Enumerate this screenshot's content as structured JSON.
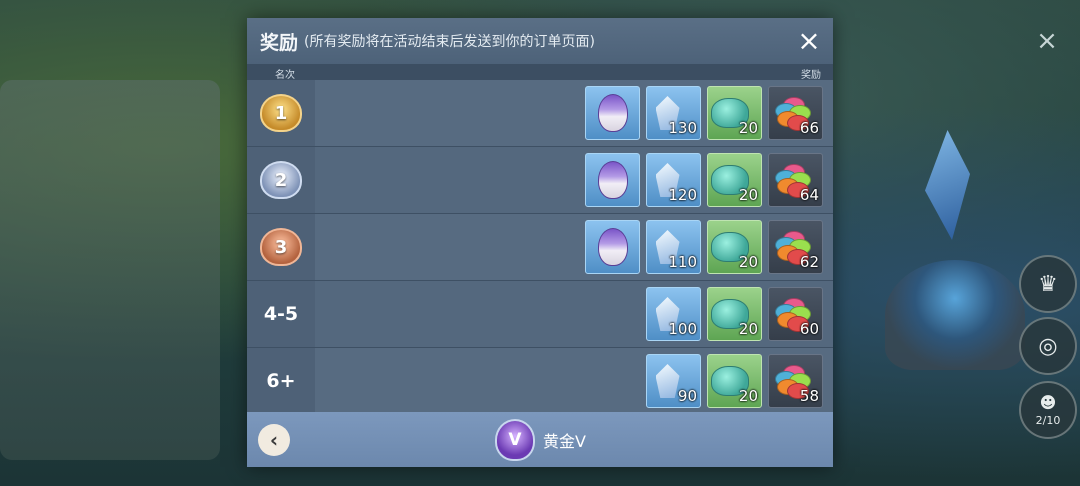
{
  "panel": {
    "title": "奖励",
    "subtitle": "(所有奖励将在活动结束后发送到你的订单页面)",
    "col_rank": "名次",
    "col_reward": "奖励",
    "close_icon": "×"
  },
  "rows": [
    {
      "rank": "1",
      "medal": "gold",
      "items": [
        {
          "type": "egg",
          "qty": ""
        },
        {
          "type": "gem",
          "qty": "130"
        },
        {
          "type": "pot",
          "qty": "20"
        },
        {
          "type": "coins",
          "qty": "66"
        }
      ]
    },
    {
      "rank": "2",
      "medal": "silver",
      "items": [
        {
          "type": "egg",
          "qty": ""
        },
        {
          "type": "gem",
          "qty": "120"
        },
        {
          "type": "pot",
          "qty": "20"
        },
        {
          "type": "coins",
          "qty": "64"
        }
      ]
    },
    {
      "rank": "3",
      "medal": "bronze",
      "items": [
        {
          "type": "egg",
          "qty": ""
        },
        {
          "type": "gem",
          "qty": "110"
        },
        {
          "type": "pot",
          "qty": "20"
        },
        {
          "type": "coins",
          "qty": "62"
        }
      ]
    },
    {
      "rank": "4-5",
      "medal": "",
      "items": [
        {
          "type": "gem",
          "qty": "100"
        },
        {
          "type": "pot",
          "qty": "20"
        },
        {
          "type": "coins",
          "qty": "60"
        }
      ]
    },
    {
      "rank": "6+",
      "medal": "",
      "items": [
        {
          "type": "gem",
          "qty": "90"
        },
        {
          "type": "pot",
          "qty": "20"
        },
        {
          "type": "coins",
          "qty": "58"
        }
      ]
    }
  ],
  "footer": {
    "back_icon": "‹",
    "tier_letter": "V",
    "tier_name": "黄金V"
  },
  "side": {
    "progress": "2/10"
  },
  "icons": {
    "egg": "dragon-egg-icon",
    "gem": "crystal-gem-icon",
    "pot": "jade-pot-icon",
    "coins": "coin-stack-icon"
  }
}
